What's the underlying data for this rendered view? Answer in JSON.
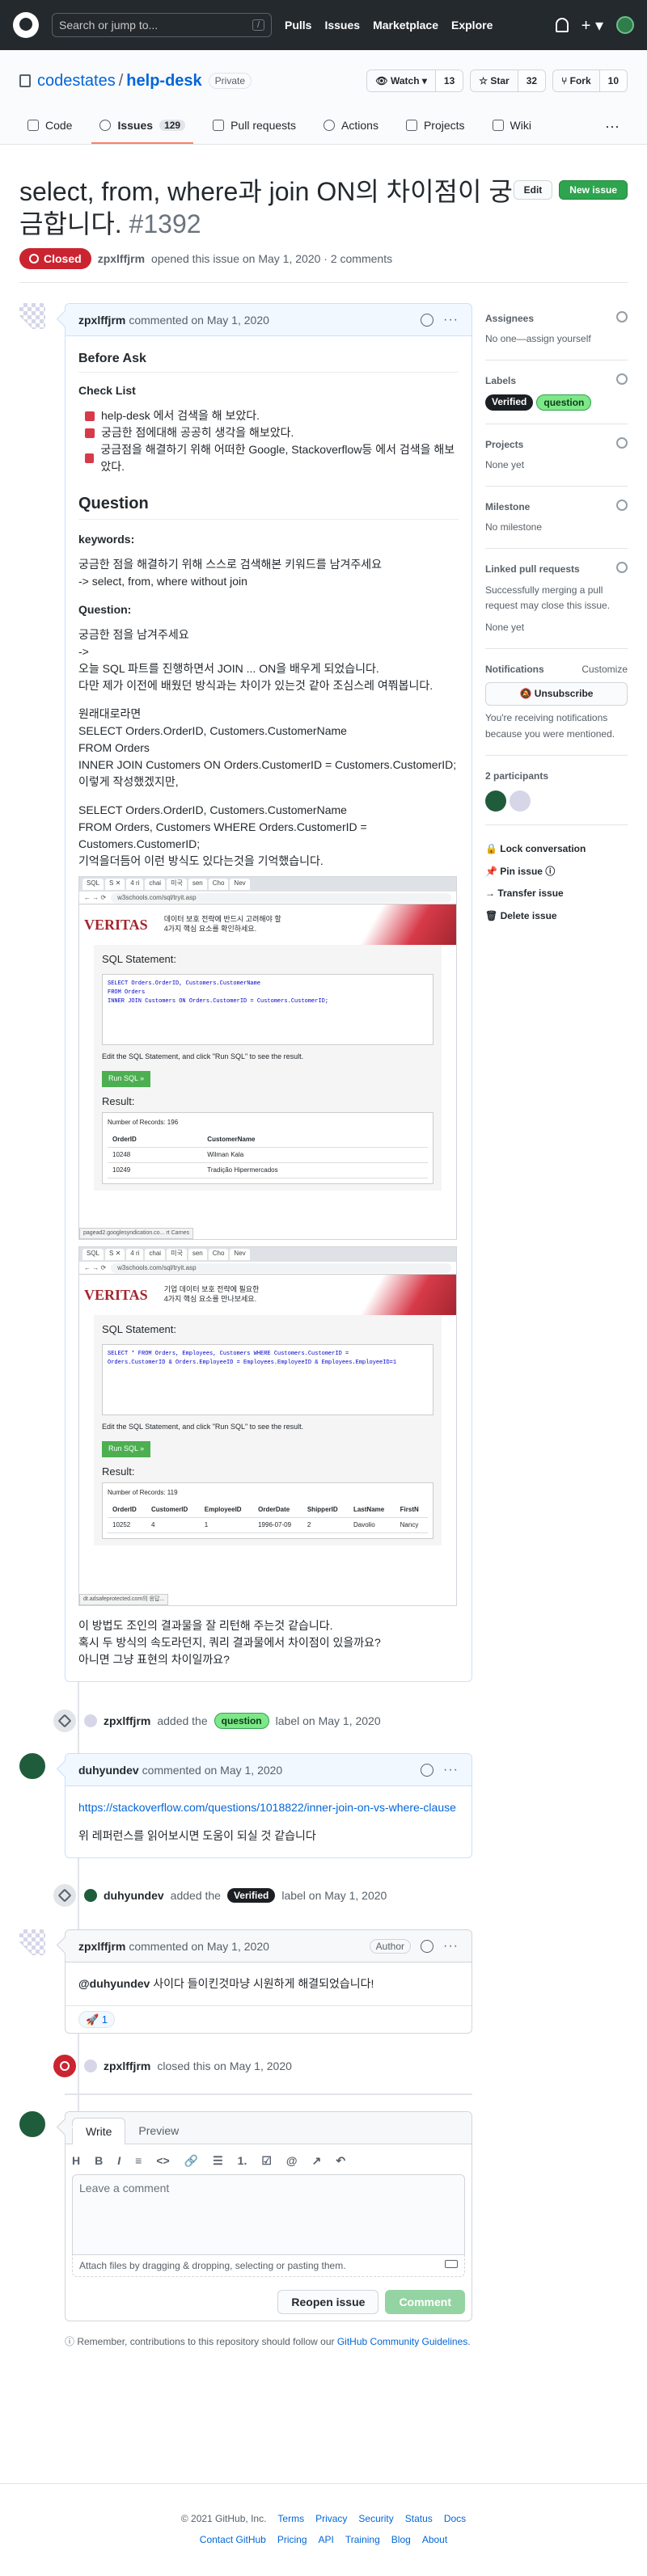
{
  "header": {
    "search_placeholder": "Search or jump to...",
    "slash": "/",
    "nav": [
      "Pulls",
      "Issues",
      "Marketplace",
      "Explore"
    ]
  },
  "repo": {
    "owner": "codestates",
    "sep": "/",
    "name": "help-desk",
    "visibility": "Private",
    "watch_label": "Watch",
    "watch_count": "13",
    "star_label": "Star",
    "star_count": "32",
    "fork_label": "Fork",
    "fork_count": "10"
  },
  "tabs": [
    {
      "label": "Code"
    },
    {
      "label": "Issues",
      "count": "129"
    },
    {
      "label": "Pull requests"
    },
    {
      "label": "Actions"
    },
    {
      "label": "Projects"
    },
    {
      "label": "Wiki"
    }
  ],
  "tabs_more": "···",
  "issue": {
    "title": "select, from, where과 join ON의 차이점이 궁금합니다.",
    "number": "#1392",
    "edit": "Edit",
    "new_issue": "New issue",
    "state": "Closed",
    "author": "zpxlffjrm",
    "opened_text": "opened this issue on May 1, 2020 · 2 comments"
  },
  "comment1": {
    "author": "zpxlffjrm",
    "action": "commented on May 1, 2020",
    "h_before": "Before Ask",
    "h_checklist": "Check List",
    "checks": [
      "help-desk 에서 검색을 해 보았다.",
      "궁금한 점에대해 공공히 생각을 해보았다.",
      "궁금점을 해결하기 위해 어떠한 Google, Stackoverflow등 에서 검색을 해보았다."
    ],
    "h_question": "Question",
    "h_keywords": "keywords:",
    "kw_text": "궁금한 점을 해결하기 위해 스스로 검색해본 키워드를 남겨주세요",
    "kw_value": "-> select, from, where without join",
    "h_q": "Question:",
    "q1": "궁금한 점을 남겨주세요",
    "q2": "->",
    "q3": "오늘 SQL 파트를 진행하면서 JOIN ... ON을 배우게 되었습니다.",
    "q4": "다만 제가 이전에 배웠던 방식과는 차이가 있는것 같아 조심스레 여쭤봅니다.",
    "p1": [
      "원래대로라면",
      "SELECT Orders.OrderID, Customers.CustomerName",
      "FROM Orders",
      "INNER JOIN Customers ON Orders.CustomerID = Customers.CustomerID;",
      "이렇게 작성했겠지만,"
    ],
    "p2": [
      "SELECT Orders.OrderID, Customers.CustomerName",
      "FROM Orders, Customers WHERE Orders.CustomerID =",
      "Customers.CustomerID;",
      "기억을더듬어 이런 방식도 있다는것을 기억했습니다."
    ],
    "closing": [
      "이 방법도 조인의 결과물을 잘 리턴해 주는것 같습니다.",
      "혹시 두 방식의 속도라던지, 쿼리 결과물에서 차이점이 있을까요?",
      "아니면 그냥 표현의 차이일까요?"
    ]
  },
  "shot1": {
    "tabs": [
      "SQL",
      "S ✕",
      "4 ri",
      "chai",
      "미국",
      "sen",
      "Cho",
      "Nev"
    ],
    "url": "w3schools.com/sql/tryit.asp",
    "veritas": "VERITAS",
    "ad1": "데이터 보호 전략에 반드시 고려해야 할",
    "ad2": "4가지 핵심 요소를 확인하세요.",
    "sql_title": "SQL Statement:",
    "code": [
      "SELECT Orders.OrderID, Customers.CustomerName",
      "FROM Orders",
      "INNER JOIN Customers ON Orders.CustomerID = Customers.CustomerID;"
    ],
    "note": "Edit the SQL Statement, and click \"Run SQL\" to see the result.",
    "run": "Run SQL »",
    "result": "Result:",
    "records": "Number of Records: 196",
    "cols": [
      "OrderID",
      "CustomerName"
    ],
    "rows": [
      [
        "10248",
        "Wilman Kala"
      ],
      [
        "10249",
        "Tradição Hipermercados"
      ]
    ],
    "status": "pagead2.googlesyndication.co...    rt Carnes"
  },
  "shot2": {
    "tabs": [
      "SQL",
      "S ✕",
      "4 ri",
      "chai",
      "미국",
      "sen",
      "Cho",
      "Nev"
    ],
    "url": "w3schools.com/sql/tryit.asp",
    "veritas": "VERITAS",
    "ad1": "기업 데이터 보호 전략에 필요한",
    "ad2": "4가지 핵심 요소를 만나보세요.",
    "sql_title": "SQL Statement:",
    "code": [
      "SELECT * FROM Orders, Employees, Customers WHERE Customers.CustomerID =",
      "Orders.CustomerID & Orders.EmployeeID = Employees.EmployeeID & Employees.EmployeeID=1"
    ],
    "note": "Edit the SQL Statement, and click \"Run SQL\" to see the result.",
    "run": "Run SQL »",
    "result": "Result:",
    "records": "Number of Records: 119",
    "cols": [
      "OrderID",
      "CustomerID",
      "EmployeeID",
      "OrderDate",
      "ShipperID",
      "LastName",
      "FirstN"
    ],
    "rows": [
      [
        "10252",
        "4",
        "1",
        "1996-07-09",
        "2",
        "Davolio",
        "Nancy"
      ]
    ],
    "status": "dt.adsafeprotected.com의 응답..."
  },
  "event1": {
    "actor": "zpxlffjrm",
    "pre": "added the",
    "label": "question",
    "post": "label on May 1, 2020"
  },
  "comment2": {
    "author": "duhyundev",
    "action": "commented on May 1, 2020",
    "link": "https://stackoverflow.com/questions/1018822/inner-join-on-vs-where-clause",
    "text": "위 레퍼런스를 읽어보시면 도움이 되실 것 같습니다"
  },
  "event2": {
    "actor": "duhyundev",
    "pre": "added the",
    "label": "Verified",
    "post": "label on May 1, 2020"
  },
  "comment3": {
    "author": "zpxlffjrm",
    "action": "commented on May 1, 2020",
    "badge": "Author",
    "mention": "@duhyundev",
    "text": "사이다 들이킨것마냥 시원하게 해결되었습니다!",
    "reaction": "🚀 1"
  },
  "event3": {
    "actor": "zpxlffjrm",
    "text": "closed this on May 1, 2020"
  },
  "editor": {
    "write": "Write",
    "preview": "Preview",
    "tools": [
      "H",
      "B",
      "I",
      "≡",
      "<>",
      "🔗",
      "☰",
      "1.",
      "☑",
      "@",
      "↗",
      "↶"
    ],
    "placeholder": "Leave a comment",
    "attach": "Attach files by dragging & dropping, selecting or pasting them.",
    "reopen": "Reopen issue",
    "comment": "Comment",
    "tip_pre": "Remember, contributions to this repository should follow our",
    "tip_link": "GitHub Community Guidelines",
    "tip_post": "."
  },
  "sidebar": {
    "assignees": "Assignees",
    "assignees_val": "No one—assign yourself",
    "labels": "Labels",
    "label_list": [
      "Verified",
      "question"
    ],
    "projects": "Projects",
    "projects_val": "None yet",
    "milestone": "Milestone",
    "milestone_val": "No milestone",
    "linked": "Linked pull requests",
    "linked_desc": "Successfully merging a pull request may close this issue.",
    "linked_val": "None yet",
    "notifications": "Notifications",
    "customize": "Customize",
    "unsubscribe": "🔕 Unsubscribe",
    "notif_desc": "You're receiving notifications because you were mentioned.",
    "participants": "2 participants",
    "actions": [
      "🔒 Lock conversation",
      "📌 Pin issue ⓘ",
      "→ Transfer issue",
      "🗑 Delete issue"
    ]
  },
  "footer": {
    "copy": "© 2021 GitHub, Inc.",
    "row1": [
      "Terms",
      "Privacy",
      "Security",
      "Status",
      "Docs"
    ],
    "row2": [
      "Contact GitHub",
      "Pricing",
      "API",
      "Training",
      "Blog",
      "About"
    ]
  }
}
